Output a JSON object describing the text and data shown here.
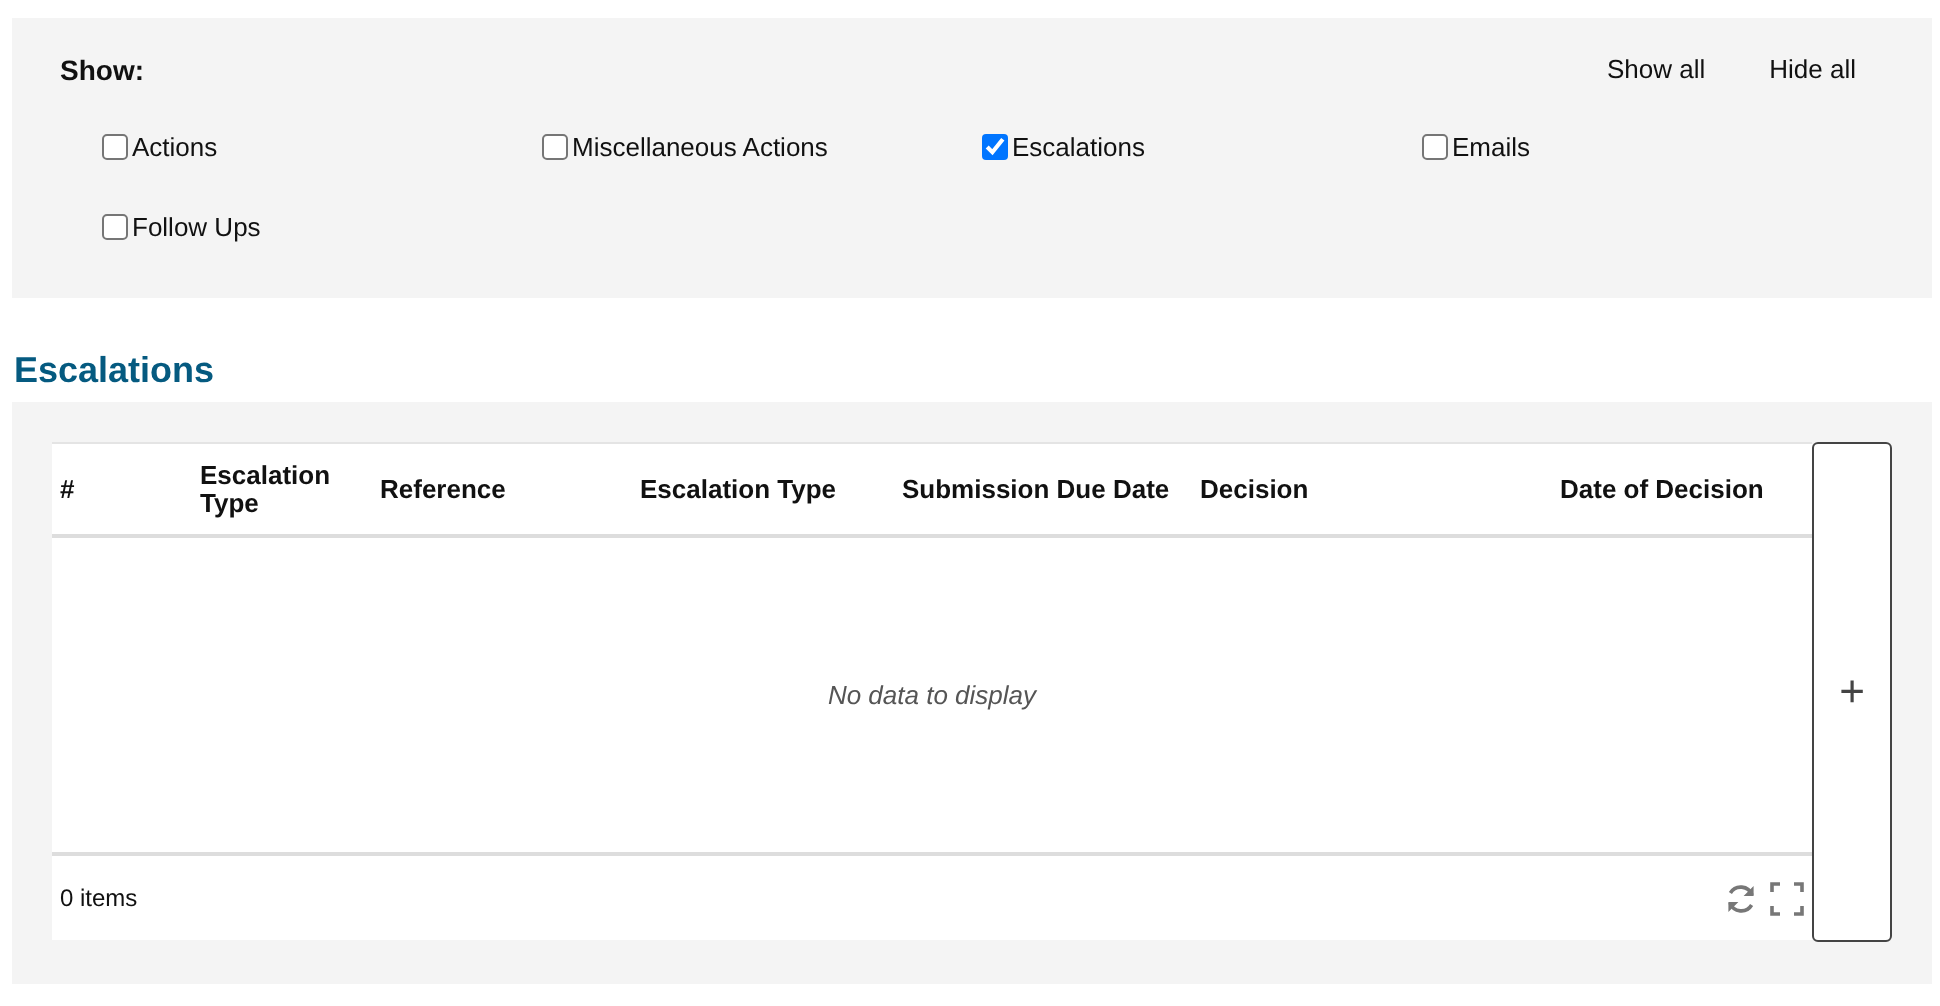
{
  "filter": {
    "label": "Show:",
    "links": [
      "Show all",
      "Hide all"
    ],
    "options": [
      {
        "label": "Actions",
        "checked": false
      },
      {
        "label": "Miscellaneous Actions",
        "checked": false
      },
      {
        "label": "Escalations",
        "checked": true
      },
      {
        "label": "Emails",
        "checked": false
      },
      {
        "label": "Follow Ups",
        "checked": false
      }
    ]
  },
  "section": {
    "title": "Escalations"
  },
  "table": {
    "columns": [
      "#",
      "Escalation Type",
      "Reference",
      "Escalation Type",
      "Submission Due Date",
      "Decision",
      "Date of Decision"
    ],
    "empty_message": "No data to display",
    "item_count": "0 items",
    "add_button": "+"
  }
}
